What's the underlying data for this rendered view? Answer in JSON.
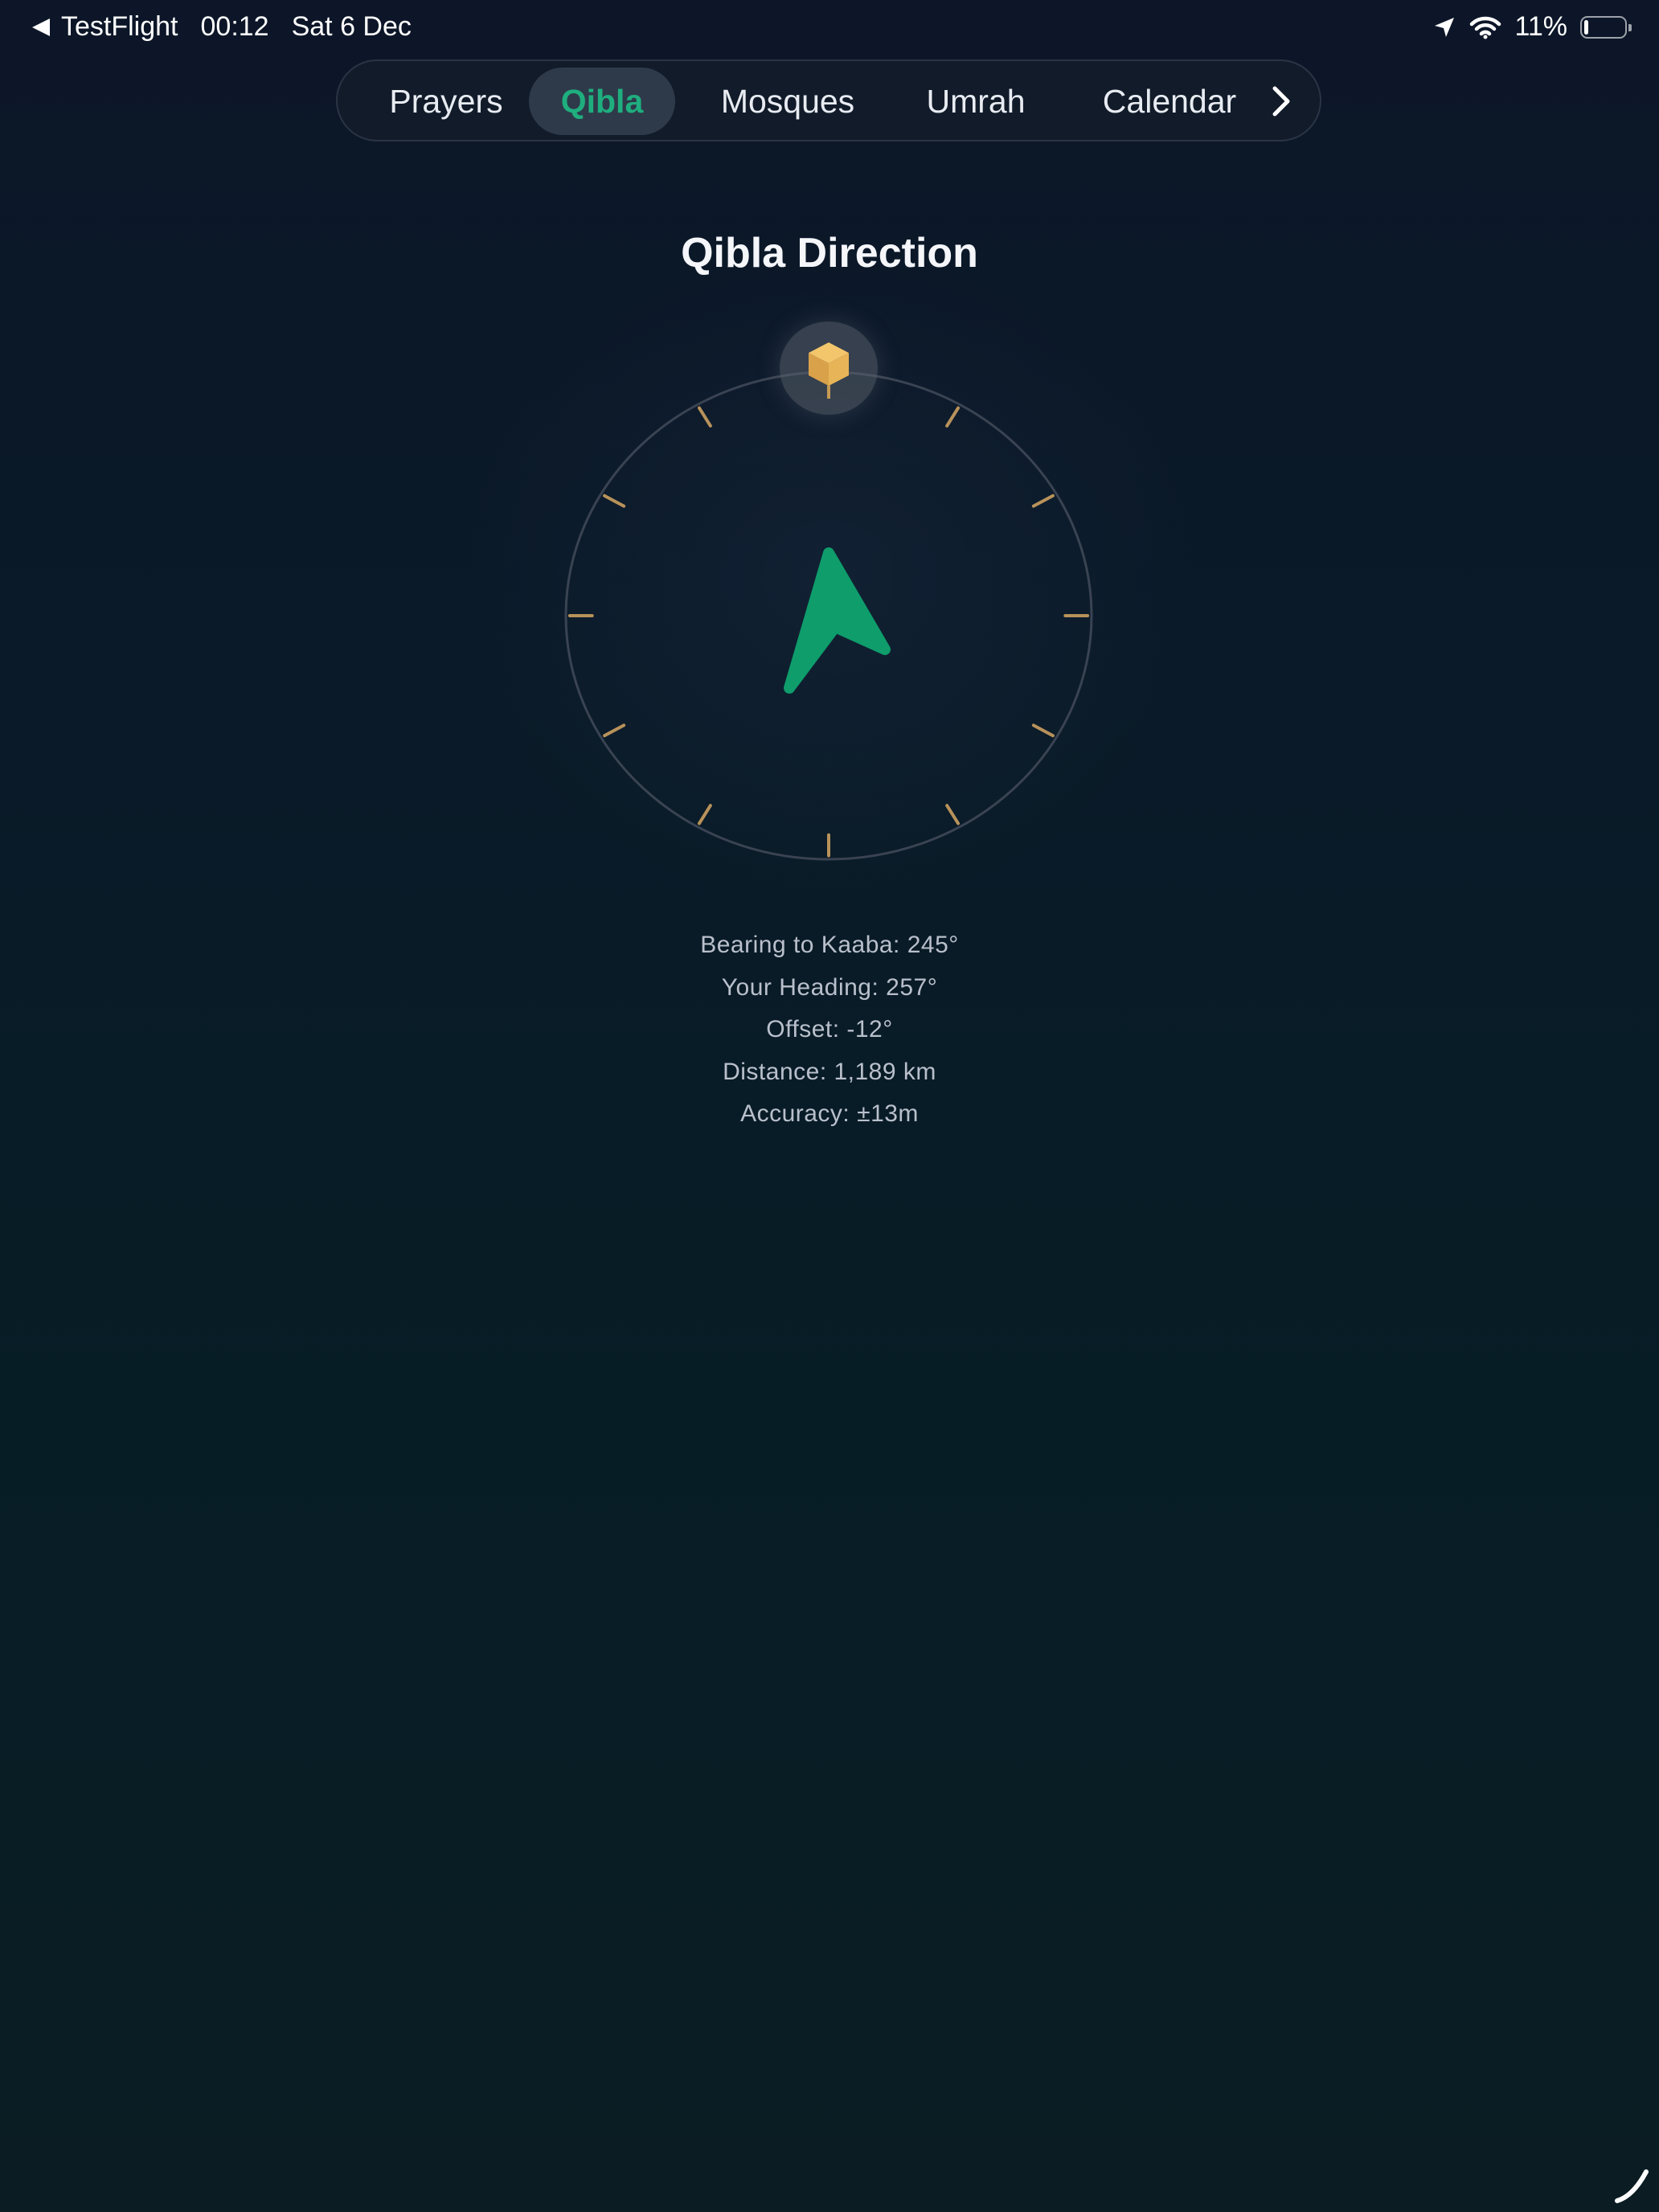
{
  "status_bar": {
    "back_app": "TestFlight",
    "time": "00:12",
    "date": "Sat 6 Dec",
    "battery_percent": "11%",
    "battery_level": 0.11
  },
  "tabs": [
    {
      "label": "Prayers",
      "active": false
    },
    {
      "label": "Qibla",
      "active": true
    },
    {
      "label": "Mosques",
      "active": false
    },
    {
      "label": "Umrah",
      "active": false
    },
    {
      "label": "Calendar",
      "active": false
    }
  ],
  "page": {
    "title": "Qibla Direction"
  },
  "compass": {
    "marker_icon": "kaaba-icon",
    "arrow_color": "#0e9d6b",
    "tick_color": "#b8925a",
    "ring_color": "#3a4352",
    "marker_color": "#e0b05c",
    "arrow_rotation_deg": -12
  },
  "info": {
    "bearing": "Bearing to Kaaba: 245°",
    "heading": "Your Heading: 257°",
    "offset": "Offset: -12°",
    "distance": "Distance: 1,189 km",
    "accuracy": "Accuracy: ±13m"
  },
  "colors": {
    "accent": "#1fae7e",
    "background_top": "#0c1628",
    "background_bottom": "#0b1d23"
  }
}
